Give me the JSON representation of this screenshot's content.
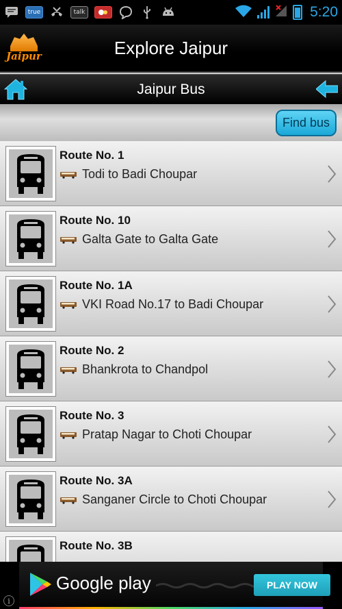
{
  "status_bar": {
    "time": "5:20",
    "icons": [
      "message-icon",
      "truecaller-icon",
      "missed-call-icon",
      "talk-icon",
      "game-icon",
      "chat-bubble-icon",
      "usb-icon",
      "android-icon",
      "wifi-icon",
      "signal-icon",
      "battery-icon"
    ],
    "badge_true": "true",
    "badge_talk": "talk",
    "accent": "#2aa7e6"
  },
  "app_bar": {
    "logo_text": "Jaipur",
    "title": "Explore Jaipur"
  },
  "page_bar": {
    "title": "Jaipur Bus"
  },
  "filter": {
    "find_label": "Find bus"
  },
  "routes": [
    {
      "number": "Route No. 1",
      "desc": "Todi to Badi Choupar"
    },
    {
      "number": "Route No. 10",
      "desc": "Galta Gate to Galta Gate"
    },
    {
      "number": "Route No. 1A",
      "desc": "VKI Road No.17 to Badi Choupar"
    },
    {
      "number": "Route No. 2",
      "desc": "Bhankrota to Chandpol"
    },
    {
      "number": "Route No. 3",
      "desc": "Pratap Nagar to Choti Choupar"
    },
    {
      "number": "Route No. 3A",
      "desc": "Sanganer Circle to Choti Choupar"
    },
    {
      "number": "Route No. 3B",
      "desc": ""
    }
  ],
  "ad": {
    "brand": "Google play",
    "cta": "PLAY NOW",
    "info": "i"
  },
  "colors": {
    "find_button": "#1aa8d8",
    "home_icon": "#1fb3e0",
    "back_icon": "#1fb3e0",
    "logo": "#ff8a00"
  }
}
